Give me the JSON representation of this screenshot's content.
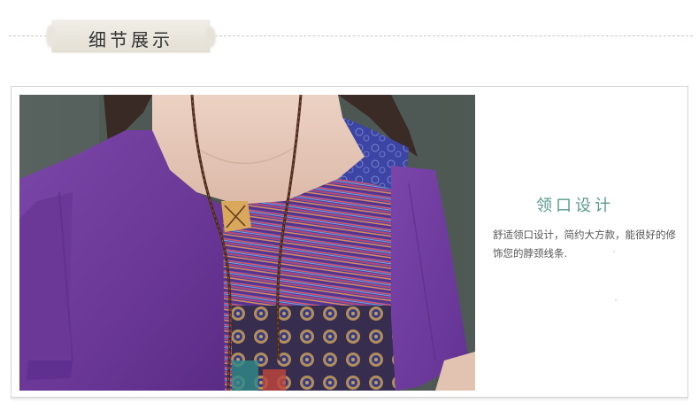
{
  "header": {
    "section_title": "细节展示"
  },
  "detail": {
    "feature_title": "领口设计",
    "feature_description": "舒适领口设计，简约大方款，能很好的修饰您的脖颈线条.",
    "photo_subject": "purple-patchwork-linen-top-with-round-neckline"
  },
  "colors": {
    "accent_teal": "#5a9a8f",
    "title_bg": "#e8e4db",
    "dress_purple": "#6e3a9b",
    "patch_blue": "#3d48a8"
  }
}
